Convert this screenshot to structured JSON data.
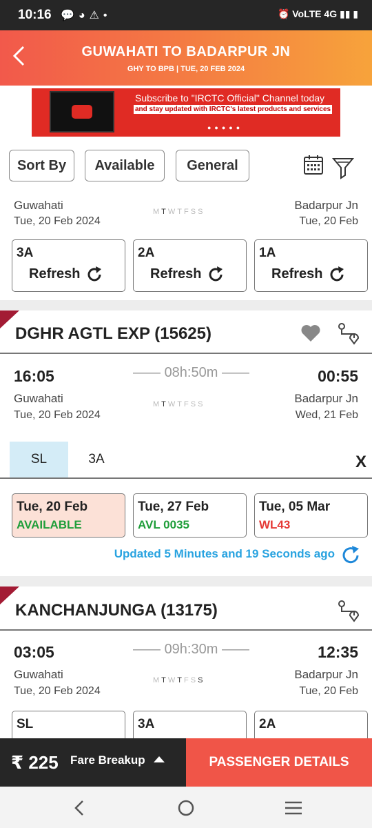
{
  "status": {
    "time": "10:16",
    "network": "4G"
  },
  "header": {
    "title": "GUWAHATI TO BADARPUR JN",
    "subtitle": "GHY TO BPB | TUE, 20 FEB  2024"
  },
  "ad": {
    "line1": "Subscribe to \"IRCTC Official\" Channel today",
    "line2": "and stay updated with IRCTC's latest products and services"
  },
  "filters": {
    "sort": "Sort By",
    "available": "Available",
    "general": "General"
  },
  "card0": {
    "from": "Guwahati",
    "from_date": "Tue, 20 Feb  2024",
    "to": "Badarpur Jn",
    "to_date": "Tue, 20 Feb",
    "classes": [
      {
        "name": "3A",
        "action": "Refresh"
      },
      {
        "name": "2A",
        "action": "Refresh"
      },
      {
        "name": "1A",
        "action": "Refresh"
      }
    ]
  },
  "train1": {
    "name": "DGHR AGTL EXP (15625)",
    "dep": "16:05",
    "arr": "00:55",
    "duration": "08h:50m",
    "from": "Guwahati",
    "from_date": "Tue, 20 Feb  2024",
    "to": "Badarpur Jn",
    "to_date": "Wed, 21 Feb",
    "tabs": [
      "SL",
      "3A"
    ],
    "close": "X",
    "avail": [
      {
        "date": "Tue, 20 Feb",
        "status": "AVAILABLE"
      },
      {
        "date": "Tue, 27 Feb",
        "status": "AVL 0035"
      },
      {
        "date": "Tue, 05 Mar",
        "status": "WL43"
      }
    ],
    "updated": "Updated 5 Minutes and 19 Seconds ago"
  },
  "train2": {
    "name": "KANCHANJUNGA (13175)",
    "dep": "03:05",
    "arr": "12:35",
    "duration": "09h:30m",
    "from": "Guwahati",
    "from_date": "Tue, 20 Feb  2024",
    "to": "Badarpur Jn",
    "to_date": "Tue, 20 Feb",
    "classes": [
      "SL",
      "3A",
      "2A"
    ]
  },
  "bottom": {
    "fare": "₹ 225",
    "fare_breakup": "Fare Breakup",
    "cta": "PASSENGER DETAILS"
  },
  "colors": {
    "available": "#1f9e3a",
    "avl": "#1f9e3a",
    "wl": "#e53935",
    "updated": "#29a3e0",
    "header_start": "#f2594b",
    "header_end": "#f7a33b"
  },
  "days": {
    "letters": [
      "M",
      "T",
      "W",
      "T",
      "F",
      "S",
      "S"
    ]
  }
}
